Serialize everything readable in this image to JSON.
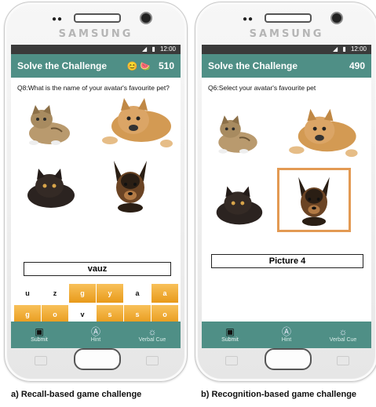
{
  "phones": [
    {
      "brand": "SAMSUNG",
      "status_time": "12:00",
      "title": "Solve the Challenge",
      "emoji": "😊 🍉",
      "score": "510",
      "question": "Q8:What is the name of your avatar's favourite pet?",
      "answer": "vauz",
      "keys_row1": [
        "u",
        "z",
        "g",
        "y",
        "a",
        "a"
      ],
      "keys_row2": [
        "g",
        "o",
        "v",
        "s",
        "s",
        "o"
      ],
      "nav": [
        "Submit",
        "Hint",
        "Verbal Cue"
      ],
      "caption": "a) Recall-based game challenge"
    },
    {
      "brand": "SAMSUNG",
      "status_time": "12:00",
      "title": "Solve the Challenge",
      "score": "490",
      "question": "Q6:Select your avatar's favourite pet",
      "answer": "Picture 4",
      "nav": [
        "Submit",
        "Hint",
        "Verbal Cue"
      ],
      "caption": "b) Recognition-based game challenge"
    }
  ],
  "pictures": [
    "tabby-cat",
    "dog",
    "black-cat",
    "shepherd-dog"
  ],
  "selected_picture": 4,
  "colors": {
    "appbar": "#4f8f86",
    "key_orange": "#eea62b",
    "selection_border": "#e39a53"
  }
}
